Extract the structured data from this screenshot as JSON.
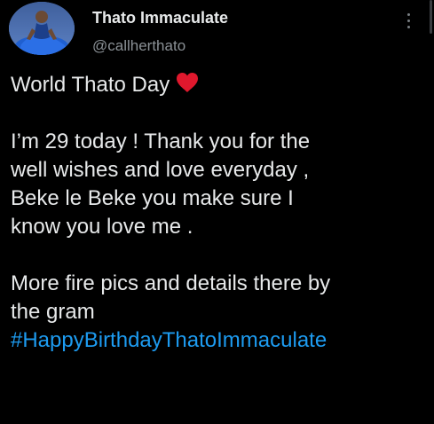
{
  "author": {
    "display_name": "Thato Immaculate",
    "handle": "@callherthato"
  },
  "tweet": {
    "title_line": "World Thato Day",
    "title_emoji": "heart-icon",
    "paragraph1": [
      "I’m 29 today ! Thank you for the",
      "well wishes and love everyday ,",
      "Beke le Beke you make sure I",
      "know you love me ."
    ],
    "paragraph2": [
      "More fire pics and details there by",
      "the gram"
    ],
    "hashtag": "#HappyBirthdayThatoImmaculate"
  },
  "colors": {
    "background": "#000000",
    "text": "#e7e9ea",
    "secondary_text": "#8b9196",
    "link": "#1d9bf0",
    "heart": "#e0182d"
  }
}
